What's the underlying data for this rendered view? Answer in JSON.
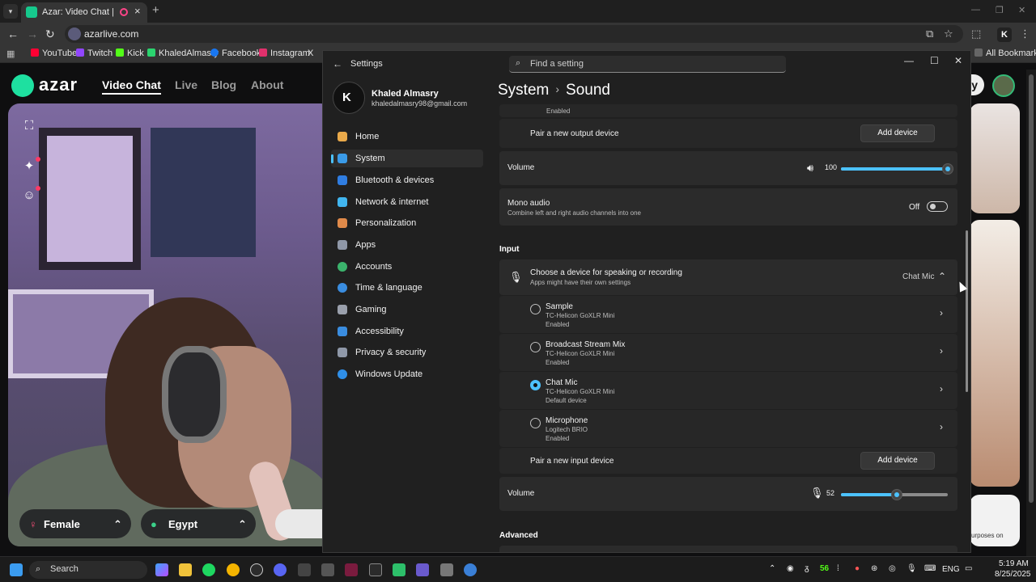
{
  "browser": {
    "tab_title": "Azar: Video Chat | Alternative",
    "url": "azarlive.com",
    "bookmarks": [
      "YouTube",
      "Twitch",
      "Kick",
      "KhaledAlmasry",
      "Facebook",
      "Instagram",
      "X"
    ],
    "all_bookmarks": "All Bookmarks"
  },
  "azar": {
    "logo": "azar",
    "nav": [
      "Video Chat",
      "Live",
      "Blog",
      "About"
    ],
    "gender_filter": "Female",
    "country_filter": "Egypt",
    "cta_letter": "y",
    "tile_caption": "urposes on"
  },
  "settings": {
    "app_title": "Settings",
    "search_placeholder": "Find a setting",
    "user": {
      "name": "Khaled Almasry",
      "email": "khaledalmasry98@gmail.com"
    },
    "nav": [
      {
        "label": "Home",
        "color": "#e9a94a"
      },
      {
        "label": "System",
        "color": "#3a9be8"
      },
      {
        "label": "Bluetooth & devices",
        "color": "#2f7de1"
      },
      {
        "label": "Network & internet",
        "color": "#41b6f0"
      },
      {
        "label": "Personalization",
        "color": "#e08a4a"
      },
      {
        "label": "Apps",
        "color": "#8f98a8"
      },
      {
        "label": "Accounts",
        "color": "#3bb36c"
      },
      {
        "label": "Time & language",
        "color": "#3a8de0"
      },
      {
        "label": "Gaming",
        "color": "#9aa0ac"
      },
      {
        "label": "Accessibility",
        "color": "#3a8de0"
      },
      {
        "label": "Privacy & security",
        "color": "#8f98a8"
      },
      {
        "label": "Windows Update",
        "color": "#2f8fe8"
      }
    ],
    "breadcrumb": {
      "parent": "System",
      "sep": "›",
      "current": "Sound"
    },
    "output": {
      "top_status": "Enabled",
      "pair_label": "Pair a new output device",
      "add_device": "Add device",
      "volume_label": "Volume",
      "volume_value": "100",
      "volume_pct": 100,
      "mono_title": "Mono audio",
      "mono_desc": "Combine left and right audio channels into one",
      "mono_state": "Off"
    },
    "input": {
      "section": "Input",
      "choose_title": "Choose a device for speaking or recording",
      "choose_desc": "Apps might have their own settings",
      "selected": "Chat Mic",
      "devices": [
        {
          "name": "Sample",
          "vendor": "TC-Helicon GoXLR Mini",
          "status": "Enabled",
          "selected": false
        },
        {
          "name": "Broadcast Stream Mix",
          "vendor": "TC-Helicon GoXLR Mini",
          "status": "Enabled",
          "selected": false
        },
        {
          "name": "Chat Mic",
          "vendor": "TC-Helicon GoXLR Mini",
          "status": "Default device",
          "selected": true
        },
        {
          "name": "Microphone",
          "vendor": "Logitech BRIO",
          "status": "Enabled",
          "selected": false
        }
      ],
      "pair_label": "Pair a new input device",
      "add_device": "Add device",
      "volume_label": "Volume",
      "volume_value": "52",
      "volume_pct": 52
    },
    "advanced": "Advanced"
  },
  "taskbar": {
    "search": "Search",
    "lang": "ENG",
    "tray_count": "56",
    "time": "5:19 AM",
    "date": "8/25/2025"
  }
}
